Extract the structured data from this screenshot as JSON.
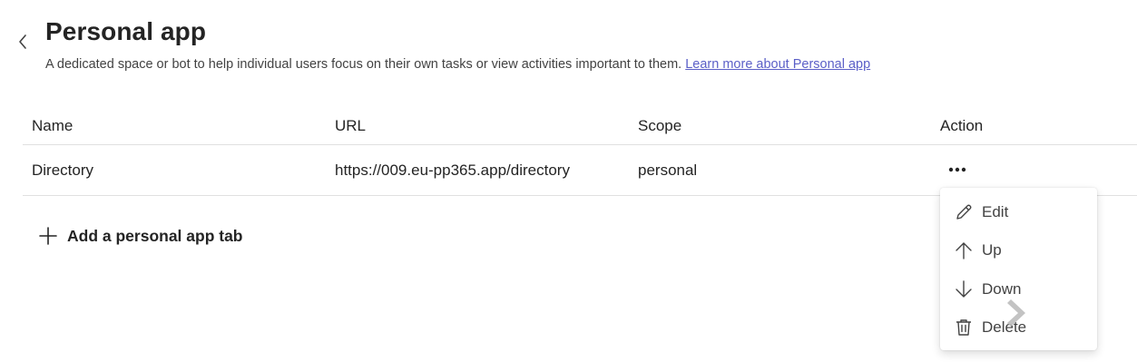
{
  "header": {
    "title": "Personal app",
    "description": "A dedicated space or bot to help individual users focus on their own tasks or view activities important to them.",
    "learn_more": "Learn more about Personal app"
  },
  "table": {
    "columns": [
      "Name",
      "URL",
      "Scope",
      "Action"
    ],
    "rows": [
      {
        "name": "Directory",
        "url": "https://009.eu-pp365.app/directory",
        "scope": "personal"
      }
    ]
  },
  "add_tab": {
    "label": "Add a personal app tab"
  },
  "menu": {
    "items": [
      {
        "label": "Edit",
        "icon": "pencil-icon"
      },
      {
        "label": "Up",
        "icon": "arrow-up-icon"
      },
      {
        "label": "Down",
        "icon": "arrow-down-icon"
      },
      {
        "label": "Delete",
        "icon": "trash-icon"
      }
    ]
  },
  "colors": {
    "link": "#5b5fc7",
    "text": "#242424",
    "divider": "#e0e0e0"
  }
}
